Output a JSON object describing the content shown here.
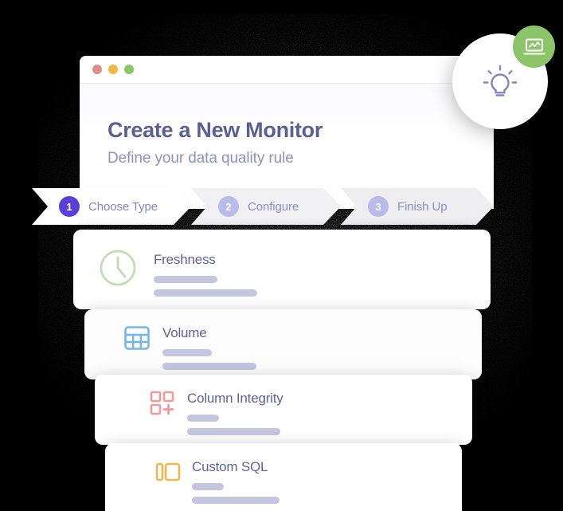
{
  "window": {
    "traffic_lights": [
      {
        "name": "close",
        "color": "#e08c8c"
      },
      {
        "name": "minimize",
        "color": "#f2b83f"
      },
      {
        "name": "maximize",
        "color": "#8cc765"
      }
    ]
  },
  "header": {
    "title": "Create a New Monitor",
    "subtitle": "Define your data quality rule",
    "title_color": "#5b5f92",
    "subtitle_color": "#8e92bd"
  },
  "stepper": {
    "active_color": "#5b3fd9",
    "inactive_color": "#b9bbe8",
    "steps": [
      {
        "number": "1",
        "label": "Choose Type",
        "state": "active"
      },
      {
        "number": "2",
        "label": "Configure",
        "state": "inactive"
      },
      {
        "number": "3",
        "label": "Finish Up",
        "state": "inactive"
      }
    ]
  },
  "monitor_types": [
    {
      "title": "Freshness",
      "icon": "clock-icon",
      "icon_color": "#bfdcae"
    },
    {
      "title": "Volume",
      "icon": "table-grid-icon",
      "icon_color": "#74b6e8"
    },
    {
      "title": "Column Integrity",
      "icon": "squares-plus-icon",
      "icon_color": "#f09a9a"
    },
    {
      "title": "Custom SQL",
      "icon": "columns-layout-icon",
      "icon_color": "#f2b84e"
    }
  ],
  "floating": {
    "bulb_icon": "lightbulb-icon",
    "bulb_color": "#8287b8",
    "badge_icon": "laptop-chart-icon",
    "badge_color": "#8cc46a"
  },
  "placeholder_bar_color": "#c3c6de"
}
